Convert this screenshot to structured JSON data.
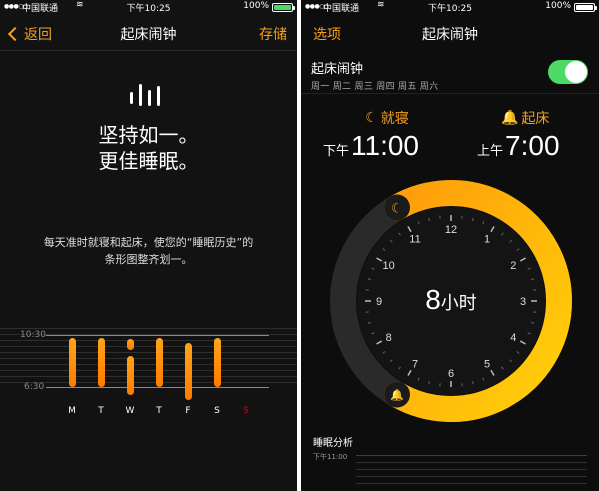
{
  "left": {
    "status": {
      "carrier": "中国联通",
      "time": "下午10:25",
      "battery": "100%"
    },
    "nav": {
      "back_label": "返回",
      "title": "起床闹钟",
      "save_label": "存储"
    },
    "headline": [
      "坚持如一。",
      "更佳睡眠。"
    ],
    "description": "每天准时就寝和起床，使您的“睡眠历史”的条形图整齐划一。",
    "chart_data": {
      "type": "bar",
      "y_labels": [
        "10:30",
        "6:30"
      ],
      "categories": [
        "M",
        "T",
        "W",
        "T",
        "F",
        "S",
        "S"
      ],
      "highlight_color": "#d0021b",
      "bars": [
        {
          "start": 0.05,
          "end": 1.0
        },
        {
          "start": 0.05,
          "end": 1.0
        },
        {
          "start": 0.08,
          "end": 0.28,
          "start2": 0.4,
          "end2": 1.15
        },
        {
          "start": 0.05,
          "end": 1.0
        },
        {
          "start": 0.15,
          "end": 1.25
        },
        {
          "start": 0.05,
          "end": 1.0
        }
      ]
    }
  },
  "right": {
    "status": {
      "carrier": "中国联通",
      "time": "下午10:25",
      "battery": "100%"
    },
    "nav": {
      "left_label": "选项",
      "title": "起床闹钟"
    },
    "alarm": {
      "title": "起床闹钟",
      "days": "周一 周二 周三 周四 周五 周六",
      "enabled": true
    },
    "bedtime": {
      "label": "就寝",
      "prefix": "下午",
      "time": "11:00"
    },
    "wakeup": {
      "label": "起床",
      "prefix": "上午",
      "time": "7:00"
    },
    "duration": {
      "value": "8",
      "unit": "小时"
    },
    "dial_numbers": [
      "12",
      "1",
      "2",
      "3",
      "4",
      "5",
      "6",
      "7",
      "8",
      "9",
      "10",
      "11"
    ],
    "analysis": {
      "title": "睡眠分析",
      "sub": "下午11:00"
    },
    "accent": "#f7a01a"
  }
}
